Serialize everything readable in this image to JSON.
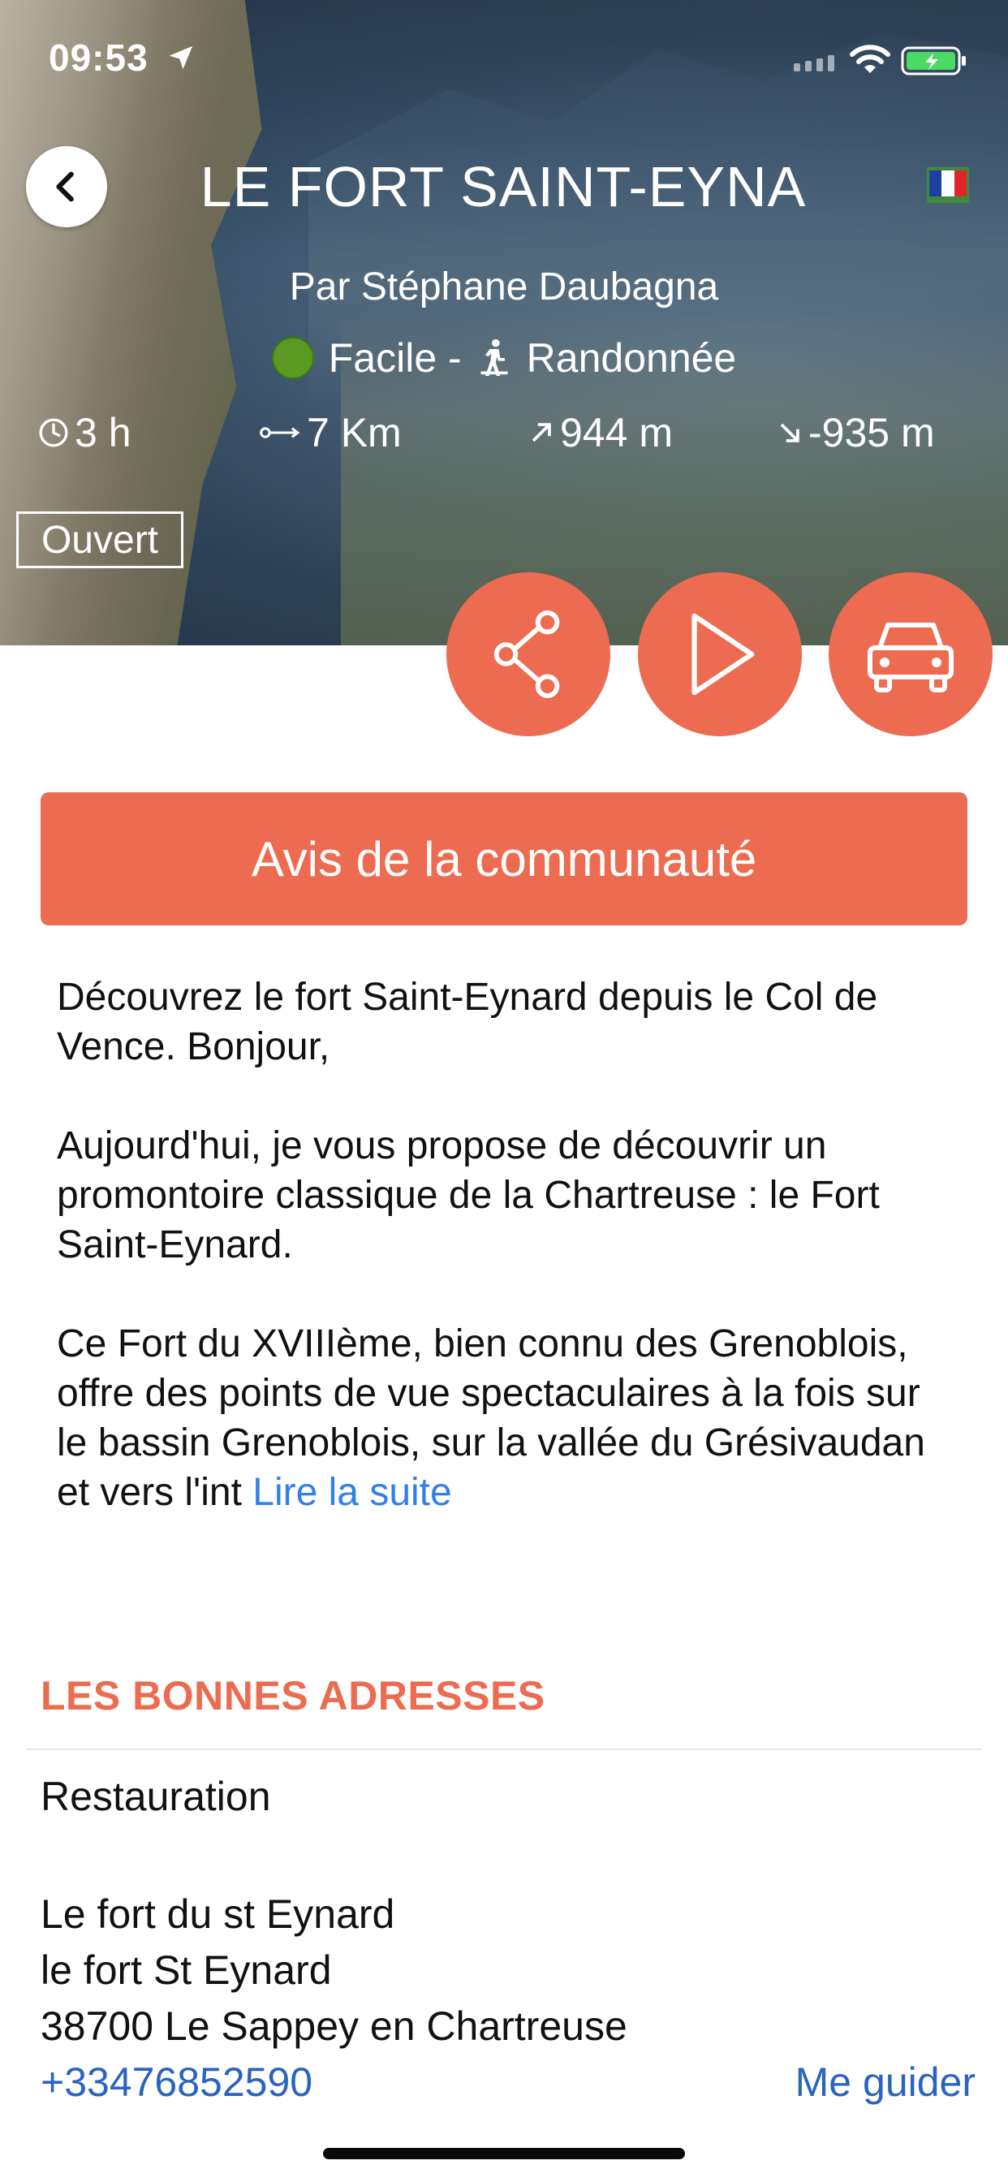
{
  "status_bar": {
    "time": "09:53"
  },
  "header": {
    "title": "LE FORT SAINT-EYNA",
    "author": "Par Stéphane Daubagna",
    "difficulty": "Facile -",
    "activity": "Randonnée",
    "stats": {
      "duration": "3 h",
      "distance": "7 Km",
      "ascent": "944 m",
      "descent": "-935 m"
    },
    "status": "Ouvert"
  },
  "actions": {
    "community_button": "Avis de la communauté"
  },
  "description": {
    "paragraph1": "Découvrez le fort Saint-Eynard depuis le Col de Vence. Bonjour,",
    "paragraph2": "Aujourd'hui, je vous propose de découvrir un promontoire classique de la Chartreuse : le Fort Saint-Eynard.",
    "paragraph3": "Ce Fort du XVIIIème, bien connu des Grenoblois, offre des points de vue spectaculaires à la fois sur le bassin Grenoblois, sur la vallée du Grésivaudan et vers l'int",
    "read_more": "Lire la suite"
  },
  "good_addresses": {
    "section_title": "LES BONNES ADRESSES",
    "category": "Restauration",
    "place_name": "Le fort du st Eynard",
    "street": "le fort St Eynard",
    "city": "38700 Le Sappey en Chartreuse",
    "phone": "+33476852590",
    "guide_label": "Me guider"
  },
  "colors": {
    "accent": "#ec6b51",
    "link": "#2f80ed",
    "phone_link": "#2a64c0",
    "difficulty_easy": "#5a9a22"
  },
  "icons": [
    "location-arrow-icon",
    "signal-icon",
    "wifi-icon",
    "battery-icon",
    "back-chevron-icon",
    "french-flag-icon",
    "hiker-icon",
    "clock-icon",
    "distance-icon",
    "ascent-arrow-icon",
    "descent-arrow-icon",
    "share-icon",
    "play-icon",
    "car-icon"
  ]
}
